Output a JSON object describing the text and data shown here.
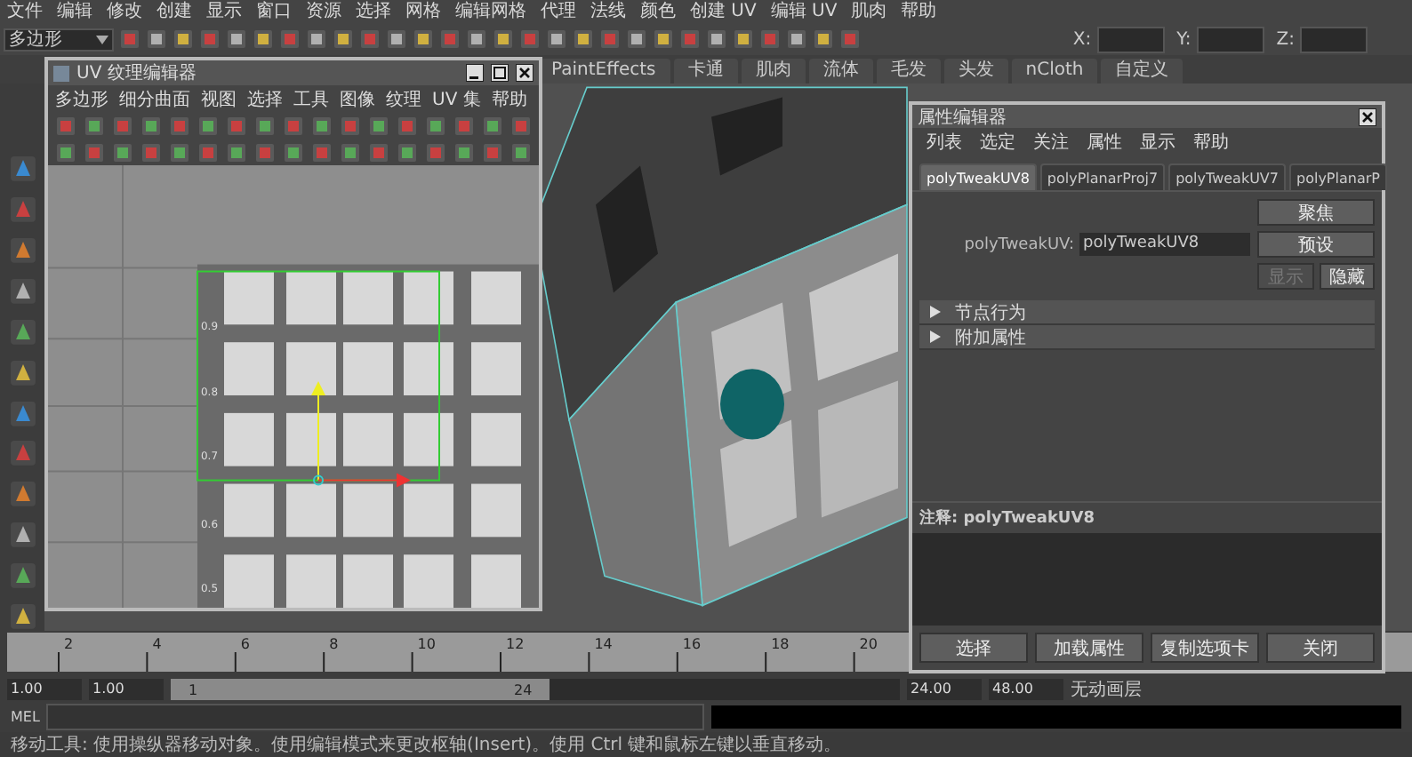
{
  "menu_bar": {
    "items": [
      "文件",
      "编辑",
      "修改",
      "创建",
      "显示",
      "窗口",
      "资源",
      "选择",
      "网格",
      "编辑网格",
      "代理",
      "法线",
      "颜色",
      "创建 UV",
      "编辑 UV",
      "肌肉",
      "帮助"
    ]
  },
  "status_line": {
    "mode_dropdown": "多边形",
    "coord_labels": [
      "X:",
      "Y:",
      "Z:"
    ]
  },
  "shelf_tabs": [
    "PaintEffects",
    "卡通",
    "肌肉",
    "流体",
    "毛发",
    "头发",
    "nCloth",
    "自定义"
  ],
  "uv_editor": {
    "title": "UV 纹理编辑器",
    "menus": [
      "多边形",
      "细分曲面",
      "视图",
      "选择",
      "工具",
      "图像",
      "纹理",
      "UV 集",
      "帮助"
    ],
    "grid_labels": [
      "0.9",
      "0.8",
      "0.7",
      "0.6",
      "0.5"
    ]
  },
  "attribute_editor": {
    "title": "属性编辑器",
    "menus": [
      "列表",
      "选定",
      "关注",
      "属性",
      "显示",
      "帮助"
    ],
    "tabs": [
      {
        "label": "polyTweakUV8",
        "selected": true
      },
      {
        "label": "polyPlanarProj7",
        "selected": false
      },
      {
        "label": "polyTweakUV7",
        "selected": false
      },
      {
        "label": "polyPlanarP",
        "selected": false
      }
    ],
    "node_field": {
      "label": "polyTweakUV:",
      "value": "polyTweakUV8"
    },
    "side_buttons": [
      {
        "label": "聚焦",
        "disabled": false
      },
      {
        "label": "预设",
        "disabled": false
      },
      {
        "label": "显示",
        "disabled": true
      },
      {
        "label": "隐藏",
        "disabled": false
      }
    ],
    "sections": [
      {
        "label": "节点行为",
        "expanded": false
      },
      {
        "label": "附加属性",
        "expanded": false
      }
    ],
    "notes_label": "注释:  polyTweakUV8",
    "buttons": [
      "选择",
      "加载属性",
      "复制选项卡",
      "关闭"
    ]
  },
  "timeline": {
    "ticks": [
      "2",
      "4",
      "6",
      "8",
      "10",
      "12",
      "14",
      "16",
      "18",
      "20"
    ]
  },
  "range_slider": {
    "level": 0.52,
    "start_time": "1.00",
    "playback_start": "1.00",
    "range_start": "1",
    "range_end": "24",
    "playback_end": "24.00",
    "end_time": "48.00",
    "anim_layer": "无动画层"
  },
  "command_line": {
    "label": "MEL"
  },
  "help_line": "移动工具: 使用操纵器移动对象。使用编辑模式来更改枢轴(Insert)。使用 Ctrl 键和鼠标左键以垂直移动。"
}
